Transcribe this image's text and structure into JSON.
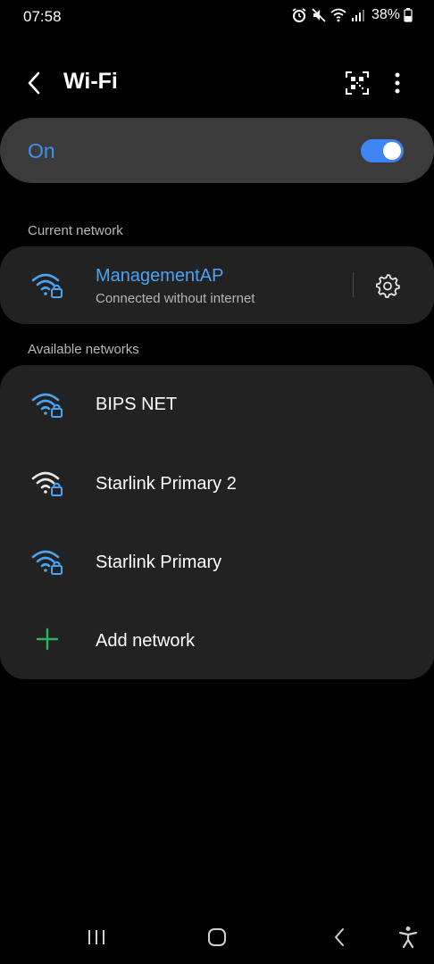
{
  "status_bar": {
    "time": "07:58",
    "battery": "38%",
    "icons": [
      "alarm-icon",
      "mute-icon",
      "wifi-icon",
      "signal-icon",
      "battery-icon"
    ]
  },
  "app_bar": {
    "title": "Wi-Fi",
    "icons": [
      "back-icon",
      "qr-scan-icon",
      "more-options-icon"
    ]
  },
  "wifi_toggle": {
    "label": "On",
    "state": "on",
    "accent_color": "#3e91ee"
  },
  "current_network": {
    "section_label": "Current network",
    "name": "ManagementAP",
    "status": "Connected without internet",
    "icon": "wifi-lock-icon",
    "settings_icon": "gear-icon"
  },
  "available_networks": {
    "section_label": "Available networks",
    "items": [
      {
        "name": "BIPS NET",
        "icon": "wifi-lock-icon",
        "icon_color": "#4aa3f5"
      },
      {
        "name": "Starlink Primary 2",
        "icon": "wifi-lock-icon",
        "icon_color": "#e8e8e8"
      },
      {
        "name": "Starlink Primary",
        "icon": "wifi-lock-icon",
        "icon_color": "#4aa3f5"
      }
    ],
    "add_label": "Add network",
    "add_icon": "plus-icon",
    "add_icon_color": "#2fb35a"
  },
  "nav_bar": {
    "icons": [
      "recents-icon",
      "home-icon",
      "back-nav-icon",
      "accessibility-icon"
    ]
  }
}
